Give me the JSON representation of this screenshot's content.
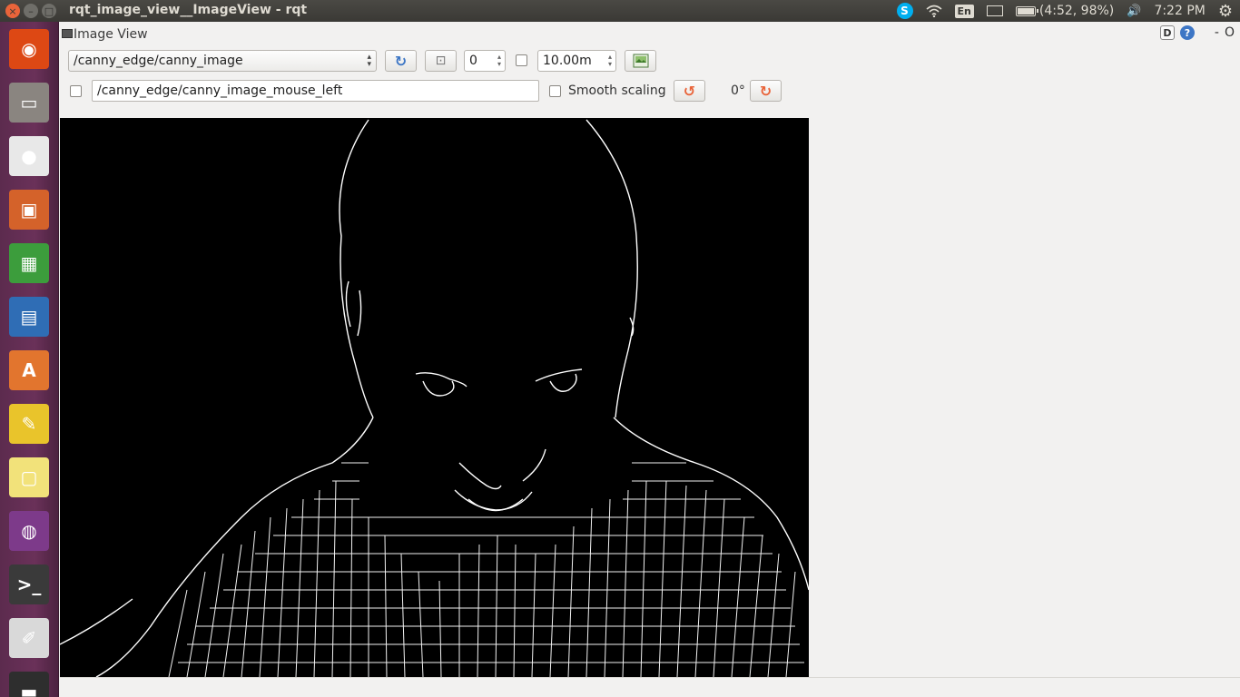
{
  "window": {
    "title": "rqt_image_view__ImageView - rqt",
    "close_glyph": "×",
    "minimize_glyph": "–",
    "maximize_glyph": "□"
  },
  "indicators": {
    "skype_glyph": "S",
    "keyboard_layout": "En",
    "battery": "(4:52, 98%)",
    "volume_glyph": "🔊",
    "clock": "7:22 PM",
    "settings_glyph": "⚙"
  },
  "launcher": {
    "items": [
      {
        "name": "ubuntu-dash-icon",
        "glyph": "◉",
        "bg": "#dd4814"
      },
      {
        "name": "files-icon",
        "glyph": "▭",
        "bg": "#8a8580"
      },
      {
        "name": "chrome-icon",
        "glyph": "●",
        "bg": "#e8e8e8"
      },
      {
        "name": "impress-icon",
        "glyph": "▣",
        "bg": "#d4622a"
      },
      {
        "name": "calc-icon",
        "glyph": "▦",
        "bg": "#3c9d3c"
      },
      {
        "name": "writer-icon",
        "glyph": "▤",
        "bg": "#2f6db5"
      },
      {
        "name": "software-center-icon",
        "glyph": "A",
        "bg": "#e2752e"
      },
      {
        "name": "text-editor-icon",
        "glyph": "✎",
        "bg": "#e9c42b"
      },
      {
        "name": "sticky-notes-icon",
        "glyph": "▢",
        "bg": "#f2e27a"
      },
      {
        "name": "color-picker-icon",
        "glyph": "◍",
        "bg": "#7d3a8a"
      },
      {
        "name": "terminal-icon",
        "glyph": ">_",
        "bg": "#3a3a3a"
      },
      {
        "name": "screenshot-icon",
        "glyph": "✐",
        "bg": "#d9d9d9"
      },
      {
        "name": "workspace-icon",
        "glyph": "▬",
        "bg": "#2e2e2e"
      }
    ]
  },
  "plugin": {
    "title": "Image View",
    "dock_glyph": "D",
    "help_glyph": "?",
    "minimize_glyph": "-",
    "close_glyph": "O"
  },
  "toolbar": {
    "topic": "/canny_edge/canny_image",
    "refresh_glyph": "↻",
    "fit_glyph": "⊡",
    "zoom_value": "0",
    "max_range_value": "10.00m",
    "save_glyph": "▣",
    "mouse_topic": "/canny_edge/canny_image_mouse_left",
    "smooth_scaling_label": "Smooth scaling",
    "rotate_left_glyph": "↺",
    "rotation_label": "0°",
    "rotate_right_glyph": "↻"
  },
  "colors": {
    "topbar": "#3c3b37",
    "launcher": "#5c2b4e",
    "window_bg": "#f2f1f0",
    "image_bg": "#000000",
    "edge": "#ffffff",
    "accent_orange": "#e9643a"
  }
}
